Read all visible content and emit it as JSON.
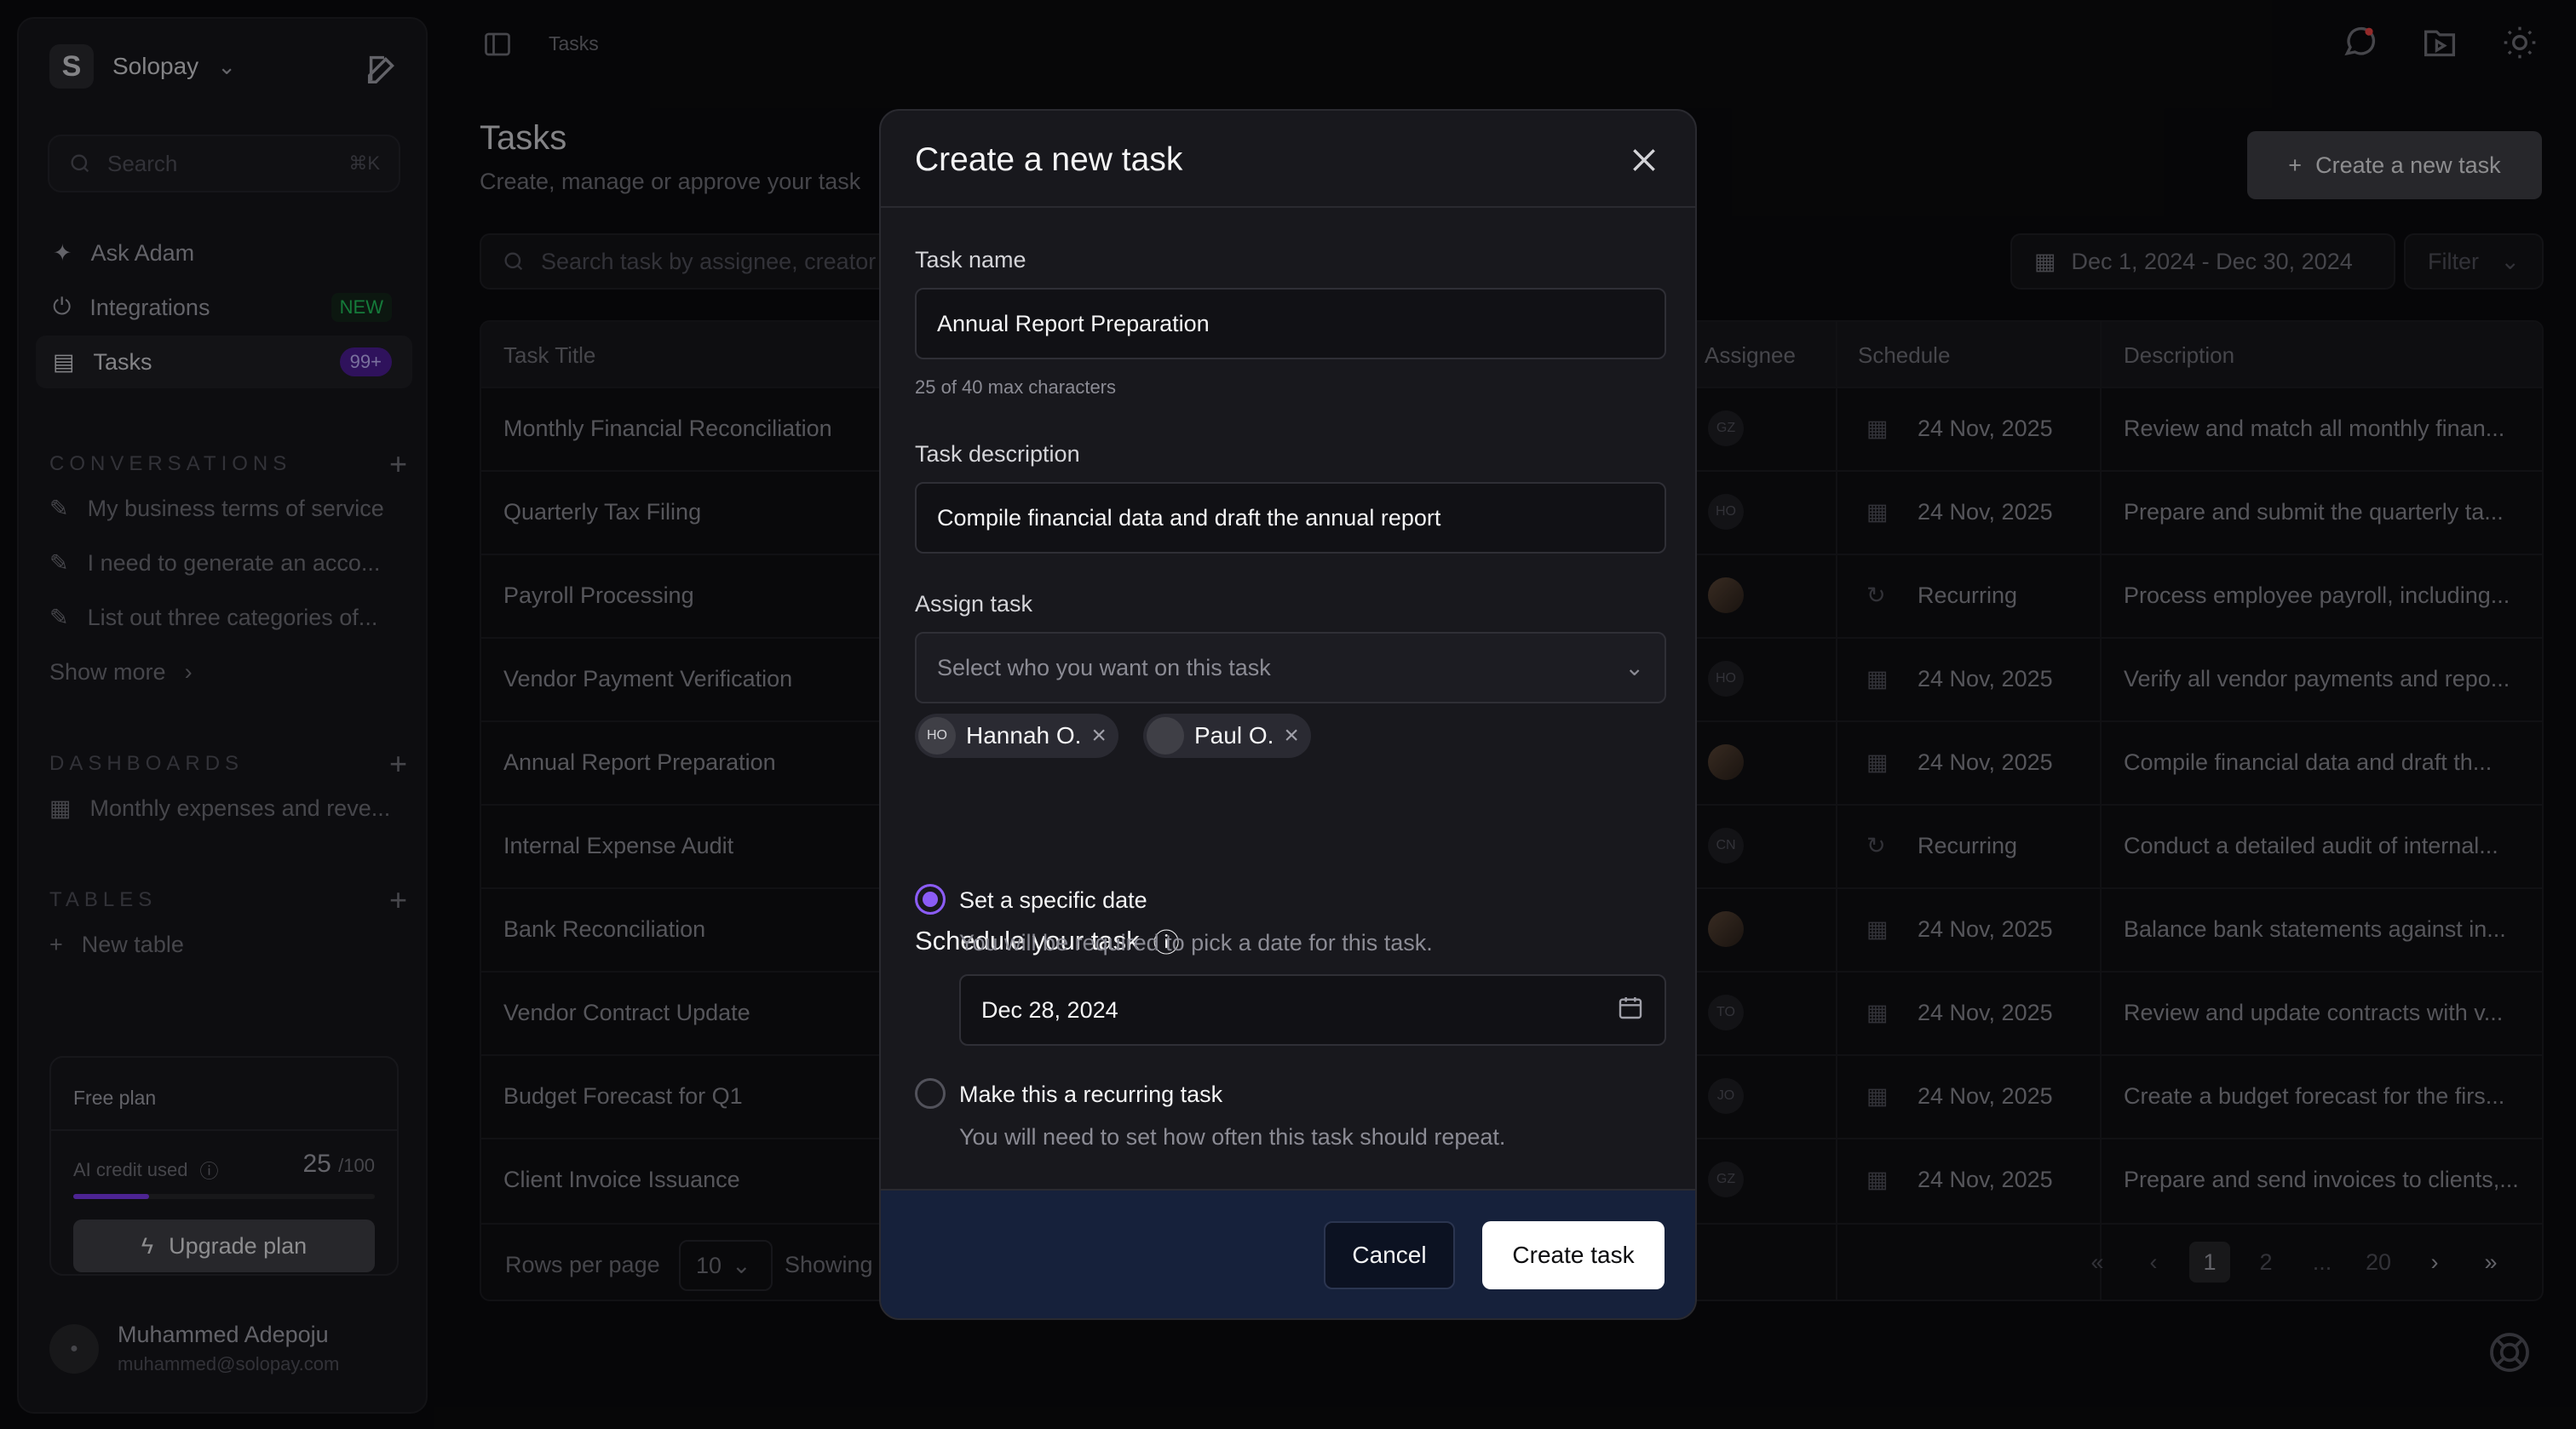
{
  "sidebar": {
    "workspace_initial": "S",
    "workspace_name": "Solopay",
    "search_placeholder": "Search",
    "search_shortcut": "⌘K",
    "nav": [
      {
        "label": "Ask Adam",
        "icon": "sparkle-icon"
      },
      {
        "label": "Integrations",
        "icon": "plug-icon",
        "badge": "NEW"
      },
      {
        "label": "Tasks",
        "icon": "clipboard-icon",
        "badge": "99+"
      }
    ],
    "conversations_title": "CONVERSATIONS",
    "conversations": [
      "My business terms of service",
      "I need to generate an acco...",
      "List out three categories of..."
    ],
    "show_more": "Show more",
    "dashboards_title": "DASHBOARDS",
    "dashboards": [
      "Monthly expenses and reve..."
    ],
    "tables_title": "TABLES",
    "new_table": "New table",
    "plan": {
      "title": "Free plan",
      "credit_label": "AI credit used",
      "credit_used": "25",
      "credit_total": "/100",
      "credit_fraction": 0.25,
      "upgrade": "Upgrade plan"
    },
    "user": {
      "name": "Muhammed Adepoju",
      "email": "muhammed@solopay.com"
    }
  },
  "header": {
    "breadcrumb": "Tasks",
    "title": "Tasks",
    "subtitle": "Create, manage or approve your task",
    "create_button": "Create a new task"
  },
  "toolbar": {
    "search_placeholder": "Search task by assignee, creator",
    "date_range": "Dec 1, 2024 - Dec 30, 2024",
    "filter": "Filter"
  },
  "table": {
    "columns": {
      "title": "Task Title",
      "assignee": "Assignee",
      "schedule": "Schedule",
      "description": "Description"
    },
    "rows": [
      {
        "title": "Monthly Financial Reconciliation",
        "assignee": "GZ",
        "schedule": "24 Nov, 2025",
        "desc": "Review and match all monthly finan..."
      },
      {
        "title": "Quarterly Tax Filing",
        "assignee": "HO",
        "schedule": "24 Nov, 2025",
        "desc": "Prepare and submit the quarterly ta..."
      },
      {
        "title": "Payroll Processing",
        "assignee": "",
        "schedule": "Recurring",
        "desc": "Process employee payroll, including..."
      },
      {
        "title": "Vendor Payment Verification",
        "assignee": "HO",
        "schedule": "24 Nov, 2025",
        "desc": "Verify all vendor payments and repo..."
      },
      {
        "title": "Annual Report Preparation",
        "assignee": "",
        "schedule": "24 Nov, 2025",
        "desc": "Compile financial data and draft th..."
      },
      {
        "title": "Internal Expense Audit",
        "assignee": "CN",
        "schedule": "Recurring",
        "desc": "Conduct a detailed audit of internal..."
      },
      {
        "title": "Bank Reconciliation",
        "assignee": "",
        "schedule": "24 Nov, 2025",
        "desc": "Balance bank statements against in..."
      },
      {
        "title": "Vendor Contract Update",
        "assignee": "TO",
        "schedule": "24 Nov, 2025",
        "desc": "Review and update contracts with v..."
      },
      {
        "title": "Budget Forecast for Q1",
        "assignee": "JO",
        "schedule": "24 Nov, 2025",
        "desc": "Create a budget forecast for the firs..."
      },
      {
        "title": "Client Invoice Issuance",
        "assignee": "GZ",
        "schedule": "24 Nov, 2025",
        "desc": "Prepare and send invoices to clients,..."
      }
    ],
    "rows_per_page_label": "Rows per page",
    "rows_per_page": "10",
    "showing": "Showing",
    "pages": [
      "1",
      "2",
      "...",
      "20"
    ]
  },
  "modal": {
    "title": "Create a new task",
    "task_name_label": "Task name",
    "task_name_value": "Annual Report Preparation",
    "task_name_hint": "25 of 40 max characters",
    "task_desc_label": "Task description",
    "task_desc_value": "Compile financial data and draft the annual report",
    "assign_label": "Assign task",
    "assign_placeholder": "Select who you want on this task",
    "assignees": [
      {
        "initials": "HO",
        "name": "Hannah O."
      },
      {
        "name": "Paul O."
      }
    ],
    "schedule_title": "Schedule your task",
    "option_specific": {
      "label": "Set a specific date",
      "desc": "You will be required to pick a date for this task.",
      "date": "Dec 28, 2024",
      "selected": true
    },
    "option_recurring": {
      "label": "Make this a recurring task",
      "desc": "You will need to set how often this task should repeat.",
      "selected": false
    },
    "cancel": "Cancel",
    "create": "Create task"
  }
}
